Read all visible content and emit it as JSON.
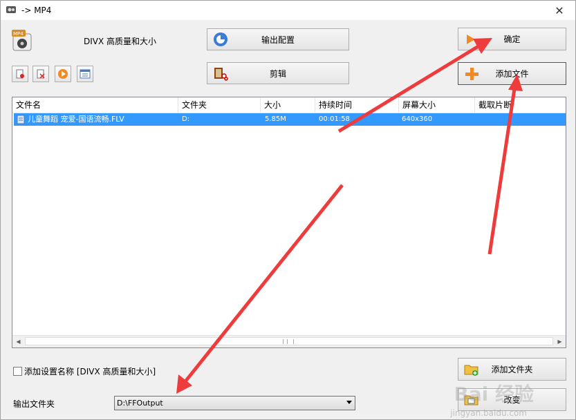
{
  "window": {
    "title": "-> MP4",
    "close_glyph": "✕"
  },
  "profile": {
    "icon": "mp4-film-icon",
    "name": "DIVX 高质量和大小"
  },
  "buttons": {
    "output_config": "输出配置",
    "edit": "剪辑",
    "ok": "确定",
    "add_file": "添加文件",
    "add_folder": "添加文件夹",
    "change": "改变"
  },
  "toolbar": [
    "remove-icon",
    "clear-icon",
    "play-icon",
    "info-icon"
  ],
  "file_list": {
    "columns": [
      "文件名",
      "文件夹",
      "大小",
      "持续时间",
      "屏幕大小",
      "截取片断"
    ],
    "rows": [
      {
        "name": "儿童舞蹈 宠爱-国语流畅.FLV",
        "folder": "D:",
        "size": "5.85M",
        "duration": "00:01:58",
        "screen": "640x360",
        "clip": ""
      }
    ]
  },
  "options": {
    "add_profile_name_label": "添加设置名称 [DIVX 高质量和大小]",
    "checked": false
  },
  "output": {
    "label": "输出文件夹",
    "folder": "D:\\FFOutput"
  },
  "watermark": {
    "main": "Bai 经验",
    "sub": "jingyan.baidu.com"
  },
  "colors": {
    "selection": "#3399ff",
    "arrow": "#ee3b3b"
  }
}
